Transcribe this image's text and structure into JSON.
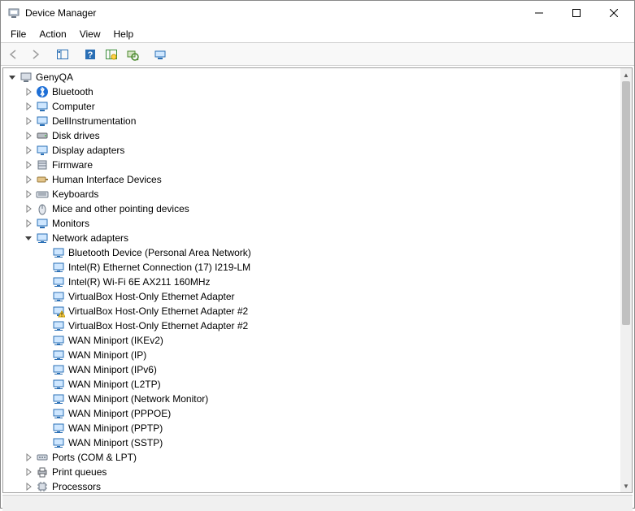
{
  "window": {
    "title": "Device Manager"
  },
  "menu": {
    "file": "File",
    "action": "Action",
    "view": "View",
    "help": "Help"
  },
  "toolbar": {
    "back": "Back",
    "forward": "Forward",
    "show_hide": "Show/Hide Console Tree",
    "help": "Help",
    "properties": "Properties",
    "scan": "Scan for hardware changes",
    "update": "Update driver"
  },
  "tree": {
    "root": {
      "label": "GenyQA",
      "icon": "computer-root",
      "expanded": true
    },
    "categories": [
      {
        "label": "Bluetooth",
        "icon": "bluetooth",
        "expanded": false
      },
      {
        "label": "Computer",
        "icon": "computer",
        "expanded": false
      },
      {
        "label": "DellInstrumentation",
        "icon": "computer",
        "expanded": false
      },
      {
        "label": "Disk drives",
        "icon": "disk",
        "expanded": false
      },
      {
        "label": "Display adapters",
        "icon": "display",
        "expanded": false
      },
      {
        "label": "Firmware",
        "icon": "firmware",
        "expanded": false
      },
      {
        "label": "Human Interface Devices",
        "icon": "hid",
        "expanded": false
      },
      {
        "label": "Keyboards",
        "icon": "keyboard",
        "expanded": false
      },
      {
        "label": "Mice and other pointing devices",
        "icon": "mouse",
        "expanded": false
      },
      {
        "label": "Monitors",
        "icon": "monitor",
        "expanded": false
      },
      {
        "label": "Network adapters",
        "icon": "network",
        "expanded": true,
        "children": [
          {
            "label": "Bluetooth Device (Personal Area Network)",
            "icon": "network"
          },
          {
            "label": "Intel(R) Ethernet Connection (17) I219-LM",
            "icon": "network"
          },
          {
            "label": "Intel(R) Wi-Fi 6E AX211 160MHz",
            "icon": "network"
          },
          {
            "label": "VirtualBox Host-Only Ethernet Adapter",
            "icon": "network"
          },
          {
            "label": "VirtualBox Host-Only Ethernet Adapter #2",
            "icon": "network-warn"
          },
          {
            "label": "VirtualBox Host-Only Ethernet Adapter #2",
            "icon": "network"
          },
          {
            "label": "WAN Miniport (IKEv2)",
            "icon": "network"
          },
          {
            "label": "WAN Miniport (IP)",
            "icon": "network"
          },
          {
            "label": "WAN Miniport (IPv6)",
            "icon": "network"
          },
          {
            "label": "WAN Miniport (L2TP)",
            "icon": "network"
          },
          {
            "label": "WAN Miniport (Network Monitor)",
            "icon": "network"
          },
          {
            "label": "WAN Miniport (PPPOE)",
            "icon": "network"
          },
          {
            "label": "WAN Miniport (PPTP)",
            "icon": "network"
          },
          {
            "label": "WAN Miniport (SSTP)",
            "icon": "network"
          }
        ]
      },
      {
        "label": "Ports (COM & LPT)",
        "icon": "ports",
        "expanded": false
      },
      {
        "label": "Print queues",
        "icon": "printer",
        "expanded": false
      },
      {
        "label": "Processors",
        "icon": "processor",
        "expanded": false
      }
    ]
  }
}
